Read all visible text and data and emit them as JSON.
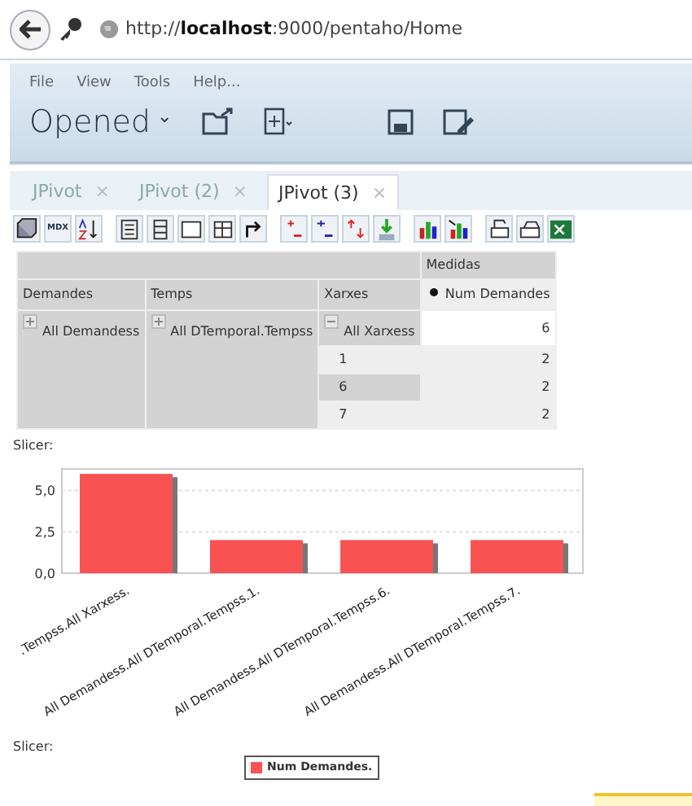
{
  "address_bar": {
    "url": "http://**localhost**:9000/pentaho/Home"
  },
  "menu": [
    "File",
    "View",
    "Tools",
    "Help..."
  ],
  "perspective": {
    "label": "Opened",
    "caret": "⌄"
  },
  "tabs": [
    {
      "label": "JPivot",
      "close": "×",
      "selected": false
    },
    {
      "label": "JPivot (2)",
      "close": "×",
      "selected": false
    },
    {
      "label": "JPivot (3)",
      "close": "×",
      "selected": true
    }
  ],
  "toolbar": {
    "mdx_label": "MDX"
  },
  "pivot": {
    "measures_header": "Medidas",
    "columns": [
      "Demandes",
      "Temps",
      "Xarxes"
    ],
    "measure": "Num Demandes",
    "members": [
      {
        "label": "All Demandess",
        "expanded": false
      },
      {
        "label": "All DTemporal.Tempss",
        "expanded": false
      },
      {
        "label": "All Xarxess",
        "expanded": true
      }
    ],
    "rows": [
      {
        "label": "",
        "value": "6"
      },
      {
        "label": "1",
        "value": "2"
      },
      {
        "label": "6",
        "value": "2"
      },
      {
        "label": "7",
        "value": "2"
      }
    ]
  },
  "slicer_top": "Slicer:",
  "chart": {
    "chart_data": {
      "type": "bar",
      "categories": [
        ".Tempss.All Xarxess.",
        "All Demandess.All DTemporal.Tempss.1.",
        "All Demandess.All DTemporal.Tempss.6.",
        "All Demandess.All DTemporal.Tempss.7."
      ],
      "series": [
        {
          "name": "Num Demandes.",
          "color": "#f95252",
          "values": [
            6,
            2,
            2,
            2
          ]
        }
      ],
      "ylim": [
        0,
        6.3
      ],
      "yticks": [
        {
          "value": 0,
          "label": "0,0"
        },
        {
          "value": 2.5,
          "label": "2,5"
        },
        {
          "value": 5,
          "label": "5,0"
        }
      ]
    }
  },
  "slicer_bottom": "Slicer:"
}
